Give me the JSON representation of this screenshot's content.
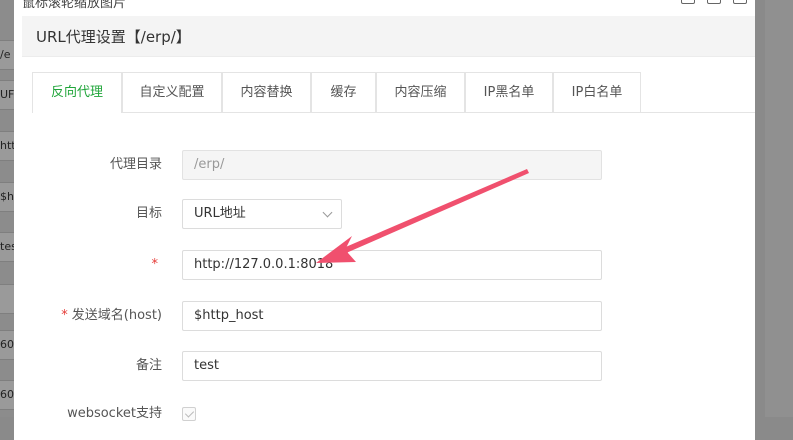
{
  "background": {
    "left_fragments": [
      "/e",
      "UF",
      "htt",
      "$h",
      "tes",
      "",
      "60",
      "60"
    ]
  },
  "modal": {
    "title": "鼠标滚轮缩放图片",
    "section_title": "URL代理设置【/erp/】",
    "window_buttons": [
      "minimize-icon",
      "restore-icon",
      "close-icon"
    ]
  },
  "tabs": [
    {
      "label": "反向代理",
      "active": true
    },
    {
      "label": "自定义配置",
      "active": false
    },
    {
      "label": "内容替换",
      "active": false
    },
    {
      "label": "缓存",
      "active": false
    },
    {
      "label": "内容压缩",
      "active": false
    },
    {
      "label": "IP黑名单",
      "active": false
    },
    {
      "label": "IP白名单",
      "active": false
    }
  ],
  "form": {
    "proxy_dir": {
      "label": "代理目录",
      "value": "/erp/"
    },
    "target": {
      "label": "目标",
      "value": "URL地址"
    },
    "url": {
      "label": "",
      "required": "*",
      "value": "http://127.0.0.1:8018"
    },
    "host": {
      "label": "发送域名(host)",
      "required": "*",
      "value": "$http_host"
    },
    "note": {
      "label": "备注",
      "value": "test"
    },
    "websocket": {
      "label": "websocket支持",
      "checked": true
    }
  },
  "annotation": {
    "color": "#f0506e",
    "type": "arrow"
  }
}
